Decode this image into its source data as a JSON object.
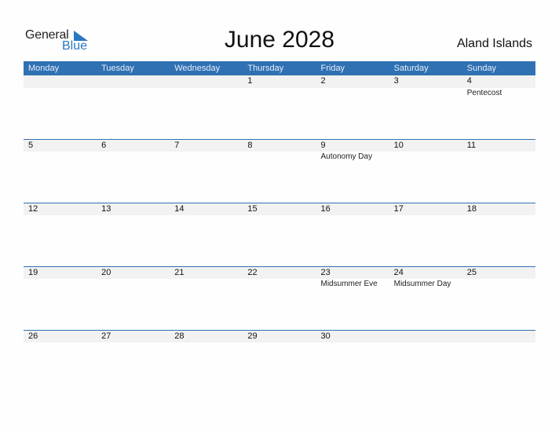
{
  "logo": {
    "general": "General",
    "blue": "Blue"
  },
  "title": "June 2028",
  "country": "Aland Islands",
  "weekdays": [
    "Monday",
    "Tuesday",
    "Wednesday",
    "Thursday",
    "Friday",
    "Saturday",
    "Sunday"
  ],
  "weeks": [
    {
      "days": [
        "",
        "",
        "",
        "1",
        "2",
        "3",
        "4"
      ],
      "events": [
        "",
        "",
        "",
        "",
        "",
        "",
        "Pentecost"
      ]
    },
    {
      "days": [
        "5",
        "6",
        "7",
        "8",
        "9",
        "10",
        "11"
      ],
      "events": [
        "",
        "",
        "",
        "",
        "Autonomy Day",
        "",
        ""
      ]
    },
    {
      "days": [
        "12",
        "13",
        "14",
        "15",
        "16",
        "17",
        "18"
      ],
      "events": [
        "",
        "",
        "",
        "",
        "",
        "",
        ""
      ]
    },
    {
      "days": [
        "19",
        "20",
        "21",
        "22",
        "23",
        "24",
        "25"
      ],
      "events": [
        "",
        "",
        "",
        "",
        "Midsummer Eve",
        "Midsummer Day",
        ""
      ]
    },
    {
      "days": [
        "26",
        "27",
        "28",
        "29",
        "30",
        "",
        ""
      ],
      "events": [
        "",
        "",
        "",
        "",
        "",
        "",
        ""
      ]
    }
  ],
  "colors": {
    "accent": "#2f71b3",
    "logo_blue": "#2a78c2",
    "band": "#f2f2f2"
  }
}
